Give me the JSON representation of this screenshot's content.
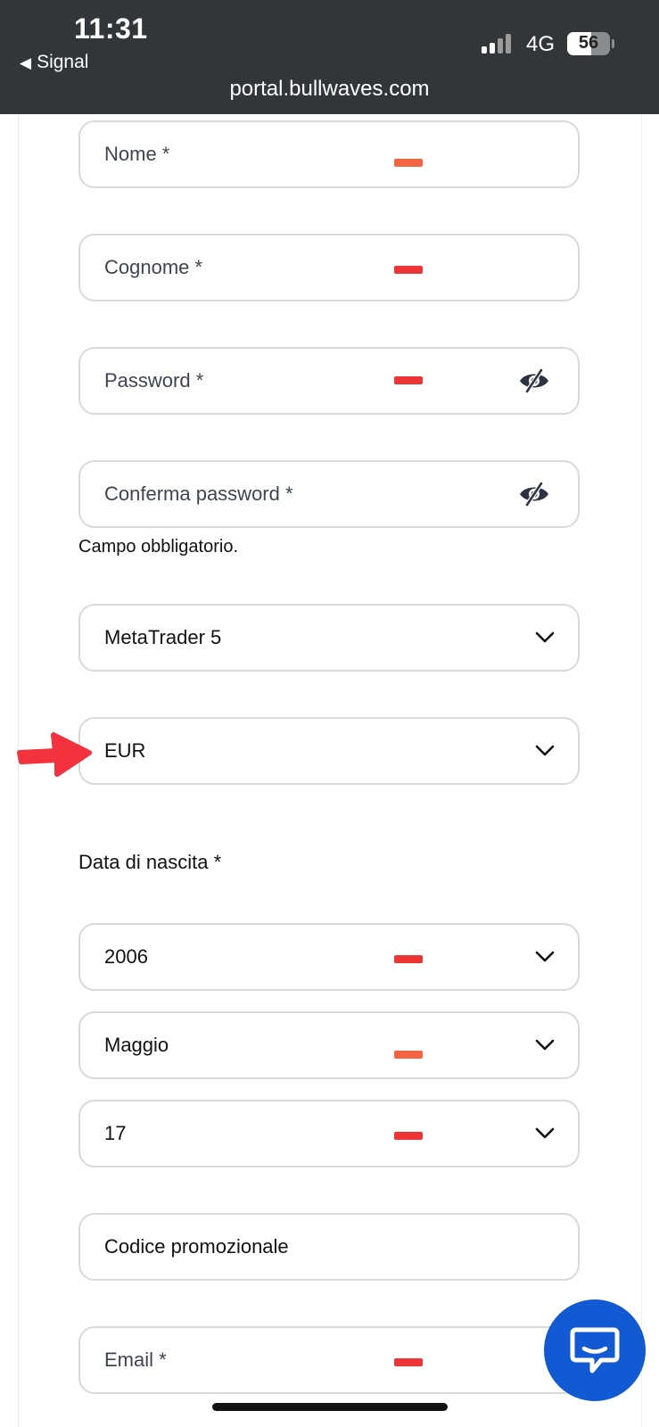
{
  "status_bar": {
    "time": "11:31",
    "back_label": "Signal",
    "network": "4G",
    "battery": "56",
    "url": "portal.bullwaves.com"
  },
  "form": {
    "nome": {
      "label": "Nome  *"
    },
    "cognome": {
      "label": "Cognome  *"
    },
    "password": {
      "label": "Password  *"
    },
    "confirm_password": {
      "label": "Conferma password  *"
    },
    "required_message": "Campo obbligatorio.",
    "platform": {
      "value": "MetaTrader 5"
    },
    "currency": {
      "value": "EUR"
    },
    "birth_date_label": "Data di nascita *",
    "birth_year": {
      "value": "2006"
    },
    "birth_month": {
      "value": "Maggio"
    },
    "birth_day": {
      "value": "17"
    },
    "promo_code": {
      "label": "Codice promozionale"
    },
    "email": {
      "label": "Email  *"
    }
  },
  "colors": {
    "status_bar_bg": "#333638",
    "redaction_red": "#ee3535",
    "redaction_orange": "#f36440",
    "annotation_arrow": "#f2323c",
    "chat_button": "#1259d4",
    "field_border": "#d9d9d9"
  },
  "icons": [
    "back-triangle-icon",
    "cellular-signal-icon",
    "battery-icon",
    "eye-slash-icon",
    "chevron-down-icon",
    "chat-bubble-icon",
    "annotation-arrow"
  ]
}
